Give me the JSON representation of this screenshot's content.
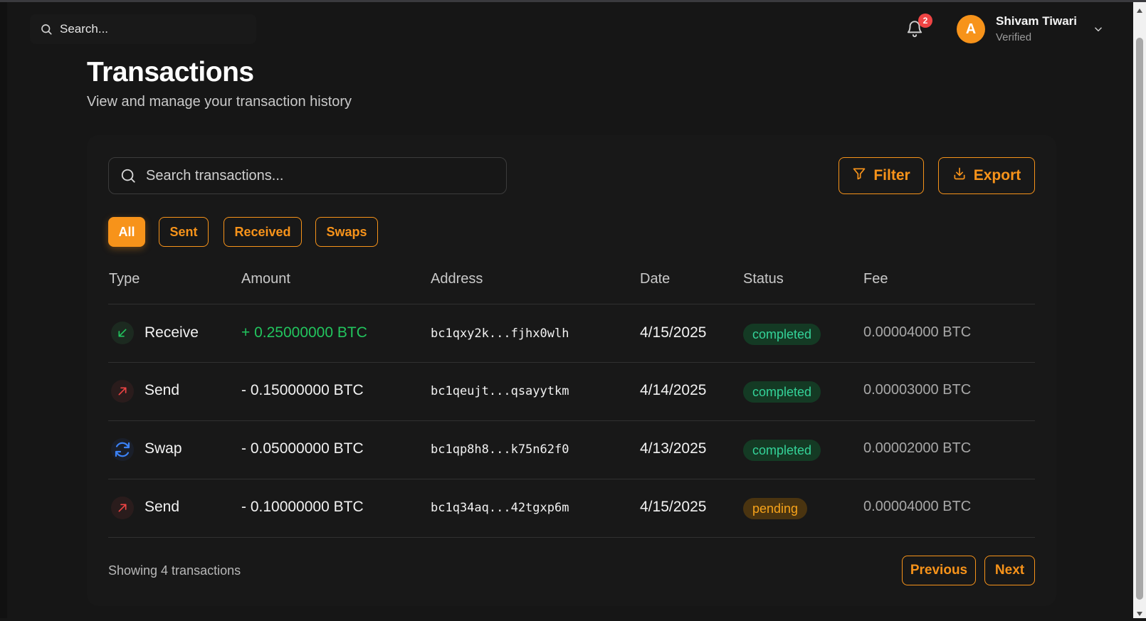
{
  "topbar": {
    "search_placeholder": "Search...",
    "notification_count": "2",
    "user": {
      "initial": "A",
      "name": "Shivam Tiwari",
      "status": "Verified"
    }
  },
  "page": {
    "title": "Transactions",
    "subtitle": "View and manage your transaction history"
  },
  "toolbar": {
    "search_placeholder": "Search transactions...",
    "filter_label": "Filter",
    "export_label": "Export"
  },
  "tabs": [
    {
      "label": "All",
      "active": true
    },
    {
      "label": "Sent",
      "active": false
    },
    {
      "label": "Received",
      "active": false
    },
    {
      "label": "Swaps",
      "active": false
    }
  ],
  "table": {
    "headers": [
      "Type",
      "Amount",
      "Address",
      "Date",
      "Status",
      "Fee"
    ],
    "rows": [
      {
        "type": "Receive",
        "icon": "arrow-down-left-icon",
        "amount": "+ 0.25000000 BTC",
        "direction": "in",
        "address": "bc1qxy2k...fjhx0wlh",
        "date": "4/15/2025",
        "status": "completed",
        "fee": "0.00004000 BTC"
      },
      {
        "type": "Send",
        "icon": "arrow-up-right-icon",
        "amount": "- 0.15000000 BTC",
        "direction": "out",
        "address": "bc1qeujt...qsayytkm",
        "date": "4/14/2025",
        "status": "completed",
        "fee": "0.00003000 BTC"
      },
      {
        "type": "Swap",
        "icon": "refresh-icon",
        "amount": "- 0.05000000 BTC",
        "direction": "out",
        "address": "bc1qp8h8...k75n62f0",
        "date": "4/13/2025",
        "status": "completed",
        "fee": "0.00002000 BTC"
      },
      {
        "type": "Send",
        "icon": "arrow-up-right-icon",
        "amount": "- 0.10000000 BTC",
        "direction": "out",
        "address": "bc1q34aq...42tgxp6m",
        "date": "4/15/2025",
        "status": "pending",
        "fee": "0.00004000 BTC"
      }
    ]
  },
  "footer": {
    "showing_text": "Showing 4 transactions",
    "previous_label": "Previous",
    "next_label": "Next"
  },
  "colors": {
    "accent": "#f7931a",
    "background": "#161616",
    "card": "#181818",
    "positive": "#22c55e",
    "completed_bg": "#143a24",
    "completed_text": "#34d399",
    "pending_bg": "#4a3410",
    "pending_text": "#f7a31a",
    "badge": "#ef4444",
    "send_icon": "#ef4444",
    "swap_icon": "#3b82f6"
  }
}
